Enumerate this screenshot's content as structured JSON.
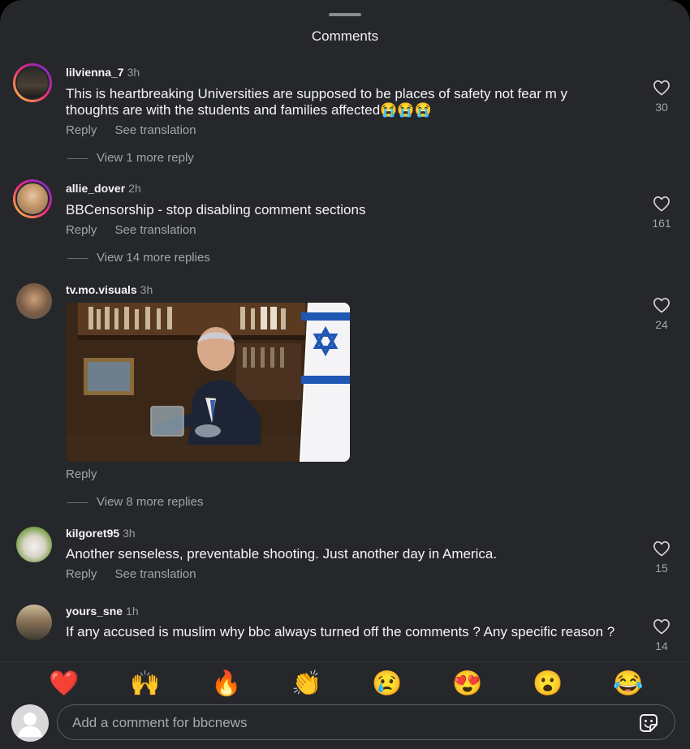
{
  "header": {
    "title": "Comments"
  },
  "comments": [
    {
      "username": "lilvienna_7",
      "time": "3h",
      "text": "This is heartbreaking Universities are supposed to be places of safety not fear m y thoughts are with the students and families affected😭😭😭",
      "reply_label": "Reply",
      "translate_label": "See translation",
      "view_more": "View 1 more reply",
      "likes": "30"
    },
    {
      "username": "allie_dover",
      "time": "2h",
      "text": "BBCensorship - stop disabling comment sections",
      "reply_label": "Reply",
      "translate_label": "See translation",
      "view_more": "View 14 more replies",
      "likes": "161"
    },
    {
      "username": "tv.mo.visuals",
      "time": "3h",
      "reply_label": "Reply",
      "view_more": "View 8 more replies",
      "likes": "24"
    },
    {
      "username": "kilgoret95",
      "time": "3h",
      "text": "Another senseless, preventable shooting. Just another day in America.",
      "reply_label": "Reply",
      "translate_label": "See translation",
      "likes": "15"
    },
    {
      "username": "yours_sne",
      "time": "1h",
      "text": "If any accused is muslim why bbc always turned off the comments ? Any specific reason ?",
      "likes": "14"
    }
  ],
  "quick_reactions": [
    "❤️",
    "🙌",
    "🔥",
    "👏",
    "😢",
    "😍",
    "😮",
    "😂"
  ],
  "composer": {
    "placeholder": "Add a comment for bbcnews"
  },
  "colors": {
    "background": "#25272b",
    "text_secondary": "#a2a4a9",
    "story_ring": "#ee2a7b"
  }
}
